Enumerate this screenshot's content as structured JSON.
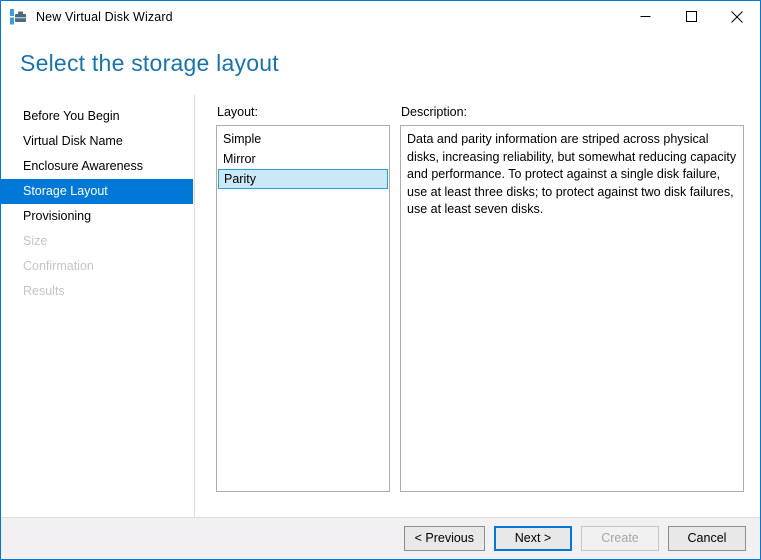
{
  "window": {
    "title": "New Virtual Disk Wizard",
    "icon": "virtual-disk-wizard-icon",
    "controls": {
      "minimize": "minimize-icon",
      "maximize": "maximize-icon",
      "close": "close-icon"
    },
    "accent_color": "#0078d7",
    "heading_color": "#1974a8"
  },
  "page": {
    "heading": "Select the storage layout"
  },
  "sidebar": {
    "items": [
      {
        "label": "Before You Begin",
        "state": "normal"
      },
      {
        "label": "Virtual Disk Name",
        "state": "normal"
      },
      {
        "label": "Enclosure Awareness",
        "state": "normal"
      },
      {
        "label": "Storage Layout",
        "state": "selected"
      },
      {
        "label": "Provisioning",
        "state": "normal"
      },
      {
        "label": "Size",
        "state": "disabled"
      },
      {
        "label": "Confirmation",
        "state": "disabled"
      },
      {
        "label": "Results",
        "state": "disabled"
      }
    ]
  },
  "layout_panel": {
    "label": "Layout:",
    "options": [
      {
        "label": "Simple",
        "selected": false
      },
      {
        "label": "Mirror",
        "selected": false
      },
      {
        "label": "Parity",
        "selected": true
      }
    ],
    "selected_value": "Parity",
    "selection_fill": "#cbe8f6",
    "selection_border": "#26a0da"
  },
  "description_panel": {
    "label": "Description:",
    "text": "Data and parity information are striped across physical disks, increasing reliability, but somewhat reducing capacity and performance. To protect against a single disk failure, use at least three disks; to protect against two disk failures, use at least seven disks."
  },
  "footer": {
    "buttons": [
      {
        "label": "< Previous",
        "state": "normal"
      },
      {
        "label": "Next >",
        "state": "default"
      },
      {
        "label": "Create",
        "state": "disabled"
      },
      {
        "label": "Cancel",
        "state": "normal"
      }
    ]
  }
}
